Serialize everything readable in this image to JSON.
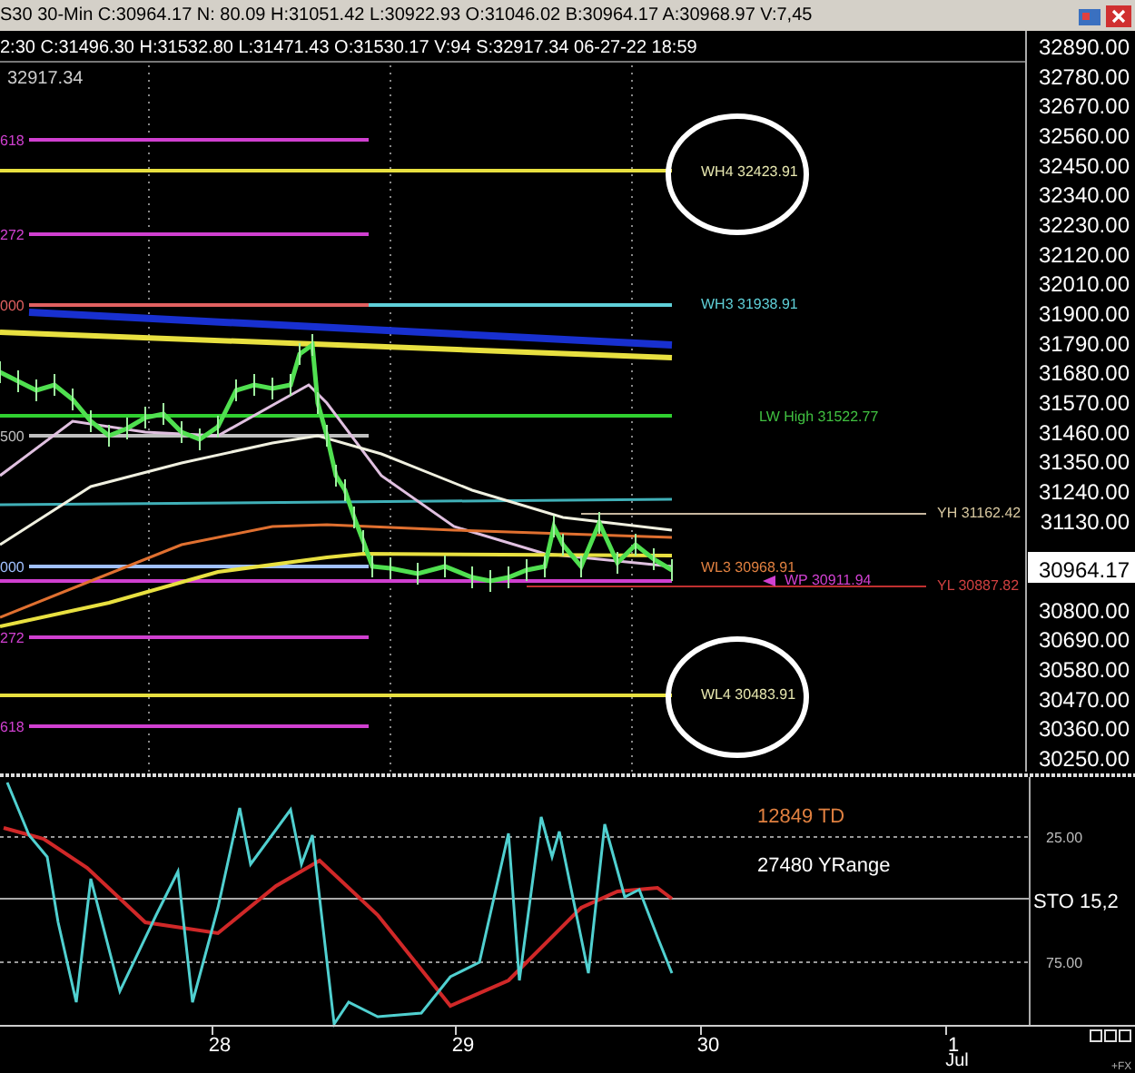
{
  "title_bar": {
    "text": "S30  30-Min  C:30964.17  N:  80.09  H:31051.42  L:30922.93  O:31046.02  B:30964.17  A:30968.97  V:7,45"
  },
  "info_bar": {
    "text": "2:30  C:31496.30  H:31532.80  L:31471.43  O:31530.17  V:94  S:32917.34  06-27-22  18:59"
  },
  "price_chart": {
    "top_label": "32917.34",
    "fib_labels": [
      "618",
      "272",
      "000",
      "500",
      "000",
      "272",
      "618"
    ],
    "level_labels": [
      {
        "text": "WH4  32423.91",
        "color": "#e8e8b0"
      },
      {
        "text": "WH3  31938.91",
        "color": "#5fd0d8"
      },
      {
        "text": "LW High  31522.77",
        "color": "#40c040"
      },
      {
        "text": "YH  31162.42",
        "color": "#d8c8a0"
      },
      {
        "text": "WL3  30968.91",
        "color": "#e08040"
      },
      {
        "text": "WP  30911.94",
        "color": "#d040d0"
      },
      {
        "text": "YL  30887.82",
        "color": "#d04040"
      },
      {
        "text": "WL4  30483.91",
        "color": "#e8e8b0"
      }
    ],
    "y_ticks": [
      "32890.00",
      "32780.00",
      "32670.00",
      "32560.00",
      "32450.00",
      "32340.00",
      "32230.00",
      "32120.00",
      "32010.00",
      "31900.00",
      "31790.00",
      "31680.00",
      "31570.00",
      "31460.00",
      "31350.00",
      "31240.00",
      "31130.00",
      "30800.00",
      "30690.00",
      "30580.00",
      "30470.00",
      "30360.00",
      "30250.00"
    ],
    "current_price": "30964.17"
  },
  "stochastic": {
    "td_label": "12849 TD",
    "yrange_label": "27480 YRange",
    "sto_label": "STO  15,2",
    "ticks": [
      "25.00",
      "75.00"
    ]
  },
  "x_axis": {
    "dates": [
      "28",
      "29",
      "30",
      "1"
    ],
    "month": "Jul",
    "corner_text": "+FX"
  }
}
